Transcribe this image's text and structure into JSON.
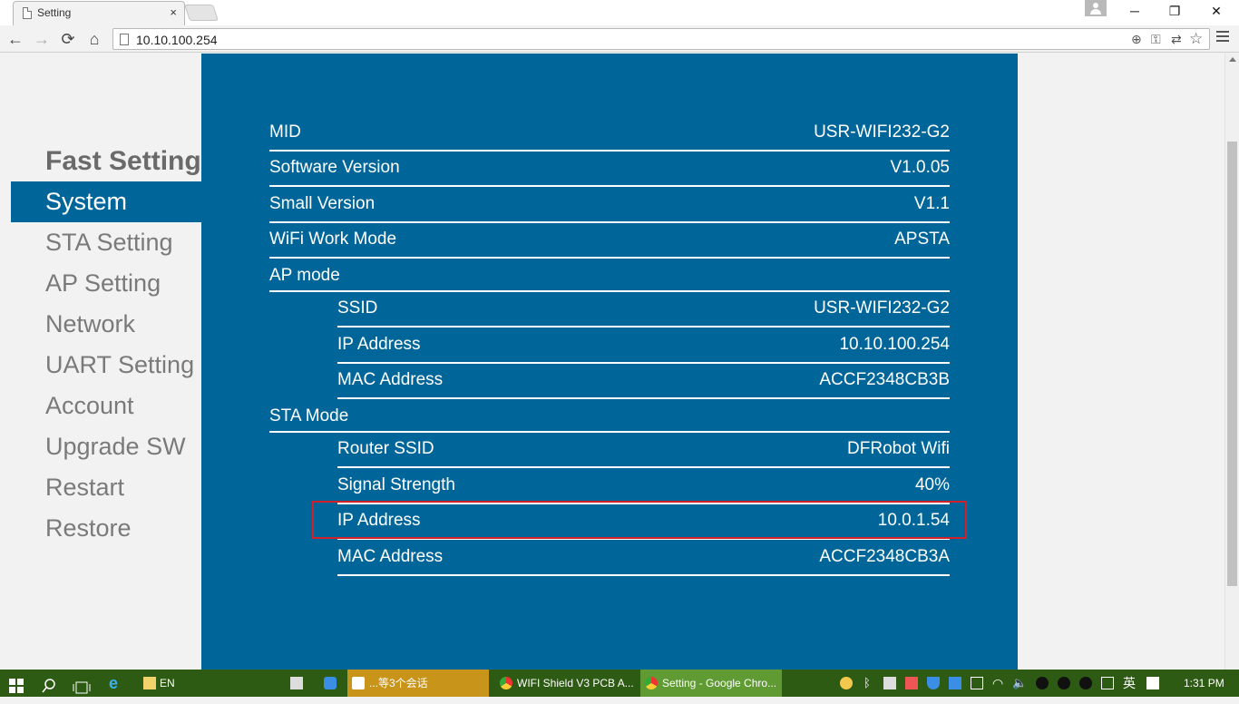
{
  "browser": {
    "tab_title": "Setting",
    "tab_close": "×",
    "url": "10.10.100.254",
    "window_controls": {
      "minimize": "─",
      "restore": "❐",
      "close": "✕"
    },
    "nav": {
      "back": "←",
      "forward": "→",
      "reload": "⟳",
      "home": "⌂"
    },
    "omni_icons": {
      "zoom": "⊕",
      "key": "⚿",
      "translate": "⇄",
      "bookmark": "☆"
    }
  },
  "sidebar": {
    "items": [
      {
        "label": "Fast Setting"
      },
      {
        "label": "System"
      },
      {
        "label": "STA Setting"
      },
      {
        "label": "AP Setting"
      },
      {
        "label": "Network"
      },
      {
        "label": "UART Setting"
      },
      {
        "label": "Account"
      },
      {
        "label": "Upgrade SW"
      },
      {
        "label": "Restart"
      },
      {
        "label": "Restore"
      }
    ]
  },
  "system": {
    "mid": {
      "label": "MID",
      "value": "USR-WIFI232-G2"
    },
    "software_version": {
      "label": "Software Version",
      "value": "V1.0.05"
    },
    "small_version": {
      "label": "Small Version",
      "value": "V1.1"
    },
    "wifi_work_mode": {
      "label": "WiFi Work Mode",
      "value": "APSTA"
    },
    "ap_mode": {
      "label": "AP mode",
      "ssid": {
        "label": "SSID",
        "value": "USR-WIFI232-G2"
      },
      "ip": {
        "label": "IP Address",
        "value": "10.10.100.254"
      },
      "mac": {
        "label": "MAC Address",
        "value": "ACCF2348CB3B"
      }
    },
    "sta_mode": {
      "label": "STA Mode",
      "router_ssid": {
        "label": "Router SSID",
        "value": "DFRobot Wifi"
      },
      "signal": {
        "label": "Signal Strength",
        "value": "40%"
      },
      "ip": {
        "label": "IP Address",
        "value": "10.0.1.54"
      },
      "mac": {
        "label": "MAC Address",
        "value": "ACCF2348CB3A"
      }
    }
  },
  "taskbar": {
    "lang": "EN",
    "tasks": [
      {
        "label": "...等3个会话"
      },
      {
        "label": "WIFI Shield V3 PCB A..."
      },
      {
        "label": "Setting - Google Chro..."
      }
    ],
    "ime": "英",
    "time": "1:31 PM"
  },
  "colors": {
    "panel": "#006699",
    "highlight": "#d0202a",
    "sidebar_text": "#7a7a7a",
    "taskbar": "#2e5b14"
  }
}
